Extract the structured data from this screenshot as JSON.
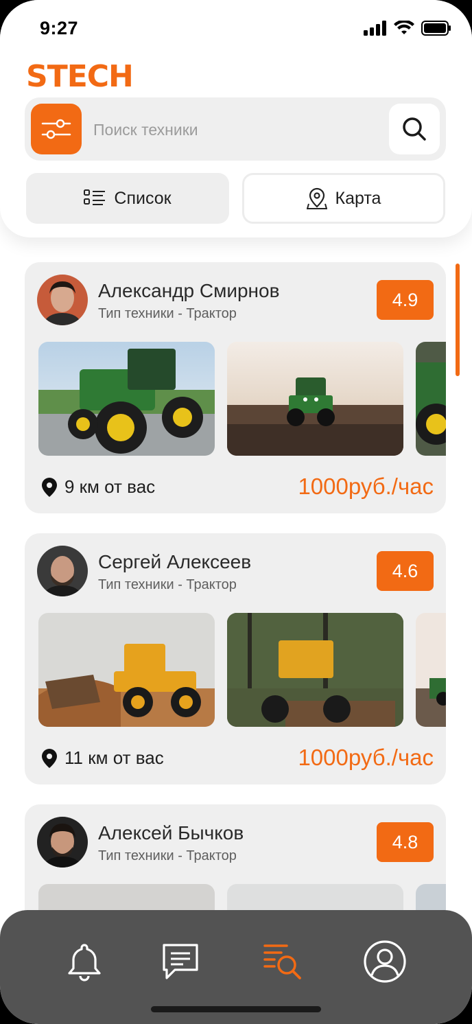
{
  "status_bar": {
    "time": "9:27"
  },
  "header": {
    "logo": "STECH",
    "search": {
      "placeholder": "Поиск техники",
      "value": ""
    },
    "segments": {
      "list_label": "Список",
      "map_label": "Карта",
      "active": "list"
    }
  },
  "colors": {
    "accent": "#f26a14",
    "card_bg": "#efefef",
    "nav_bg": "#535353"
  },
  "listings": [
    {
      "name": "Александр Смирнов",
      "subtitle": "Тип техники - Трактор",
      "rating": "4.9",
      "distance": "9 км от вас",
      "price": "1000руб./час"
    },
    {
      "name": "Сергей Алексеев",
      "subtitle": "Тип техники - Трактор",
      "rating": "4.6",
      "distance": "11 км от вас",
      "price": "1000руб./час"
    },
    {
      "name": "Алексей Бычков",
      "subtitle": "Тип техники - Трактор",
      "rating": "4.8",
      "distance": "",
      "price": ""
    }
  ],
  "bottom_nav": {
    "items": [
      {
        "icon": "bell-icon",
        "active": false
      },
      {
        "icon": "chat-icon",
        "active": false
      },
      {
        "icon": "search-list-icon",
        "active": true
      },
      {
        "icon": "profile-icon",
        "active": false
      }
    ]
  }
}
